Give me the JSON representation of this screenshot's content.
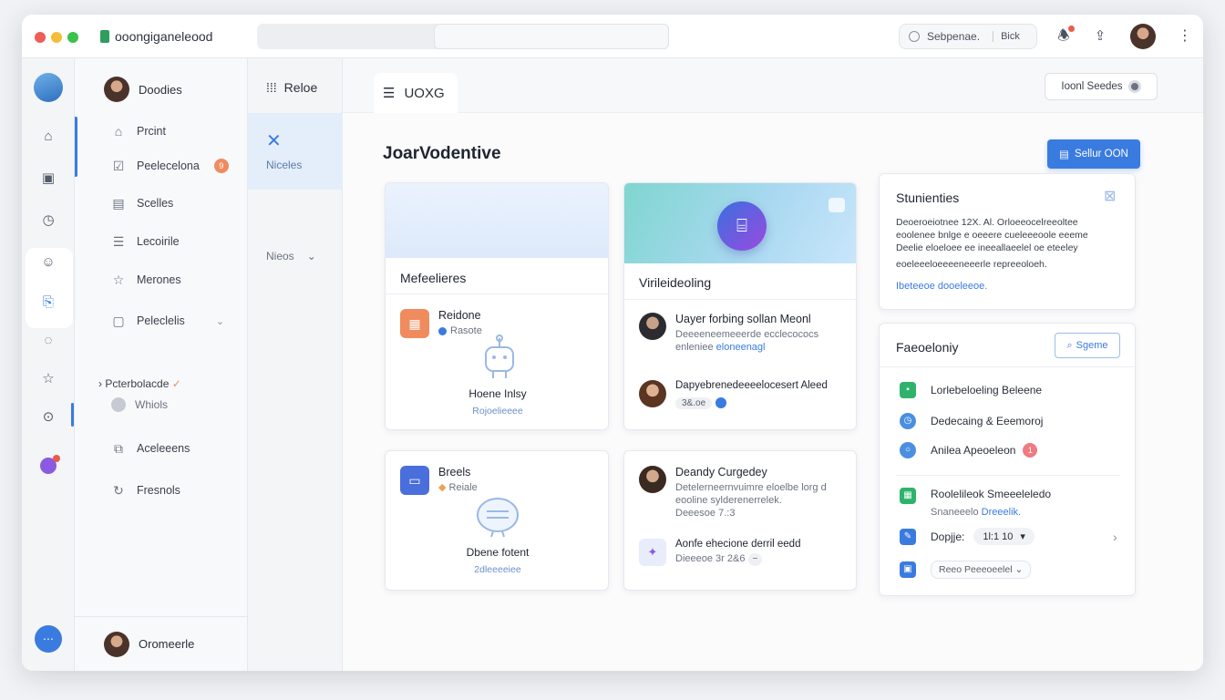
{
  "titlebar": {
    "app_name": "ooongiganeleood",
    "search_text": "Sebpenae.",
    "search_shortcut": "Bick",
    "traffic_colors": [
      "#ee5d56",
      "#f4bd3a",
      "#39c24a"
    ]
  },
  "rail": {
    "icons": [
      "home-icon",
      "square-icon",
      "clock-icon",
      "smile-icon",
      "bag-icon",
      "comment-icon",
      "star-icon",
      "info-icon",
      "chat-icon"
    ]
  },
  "sidebar": {
    "user": "Doodies",
    "items": [
      {
        "label": "Prcint",
        "icon": "house-icon"
      },
      {
        "label": "Peelecelona",
        "icon": "checkbox-icon",
        "badge": "9"
      },
      {
        "label": "Scelles",
        "icon": "doc-icon"
      },
      {
        "label": "Lecoirile",
        "icon": "list-icon"
      },
      {
        "label": "Merones",
        "icon": "star-icon"
      },
      {
        "label": "Peleclelis",
        "icon": "folder-icon"
      }
    ],
    "group_label": "Pcterbolacde",
    "group_item": "Whiols",
    "extra_items": [
      {
        "label": "Aceleeens",
        "icon": "box-icon"
      },
      {
        "label": "Fresnols",
        "icon": "refresh-icon"
      }
    ],
    "footer_user": "Oromeerle"
  },
  "col2": {
    "heading": "Reloe",
    "active_label": "Niceles",
    "dropdown_label": "Nieos"
  },
  "main": {
    "tab_label": "UOXG",
    "header_select": "Ioonl Seedes",
    "page_title": "JoarVodentive",
    "primary_button": "Sellur OON",
    "card1": {
      "title": "Mefeelieres",
      "item_title": "Reidone",
      "item_meta": "Rasote",
      "illus_title": "Hoene Inlsy",
      "illus_sub": "Rojoelieeee"
    },
    "card2": {
      "title": "Virileideoling",
      "row1_title": "Uayer forbing sollan Meonl",
      "row1_sub1": "Deeeeneemeeerde ecclecococs",
      "row1_sub2": "enleniee",
      "row1_link": "eloneenagl",
      "row2_title": "Dapyebrenedeeeelocesert Aleed",
      "row2_chip": "3&.oe"
    },
    "card3": {
      "title": "Breels",
      "meta": "Reiale",
      "illus_title": "Dbene fotent",
      "illus_sub": "2dleeeeiee"
    },
    "card4": {
      "row1_title": "Deandy Curgedey",
      "row1_sub1": "Detelerneernvuimre eloelbe lorg  d",
      "row1_sub2": "eooline sylderenerrelek.",
      "row1_sub3": "Deeesoe 7.:3",
      "row2_title": "Aonfe ehecione derril eedd",
      "row2_sub": "Dieeeoe 3r 2&6"
    },
    "summary": {
      "title": "Stunienties",
      "line1": "Deoeroeiotnee 12X.  Al. Orloeeocelreeoltee",
      "line2": "eoolenee bnlge e oeeere cueleeeoole eeeme",
      "line3": "Deelie eloeloee ee ineeallaeelel oe eteeley",
      "line4": "eoeleeeloeeeeneeerle repreeoloeh.",
      "link": "Ibeteeoe dooeleeoe."
    },
    "features": {
      "title": "Faeoeloniy",
      "button": "Sgeme",
      "rows": [
        {
          "label": "Lorlebeloeling Beleene",
          "icon": "tile-icon",
          "color": "#2fb36a"
        },
        {
          "label": "Dedecaing & Eeemoroj",
          "icon": "clock-icon",
          "color": "#4a8fe0"
        },
        {
          "label": "Anilea Apeoeleon",
          "icon": "circle-icon",
          "color": "#4a8fe0",
          "badge": "1"
        }
      ],
      "group_title": "Roolelileok Smeeeleledo",
      "group_sub": "Snaneeelo",
      "group_link": "Dreeelik.",
      "select_label": "Dopjje:",
      "select_value": "1l:1   10",
      "bottom_chip": "Reeo Peeeoeelel"
    }
  }
}
